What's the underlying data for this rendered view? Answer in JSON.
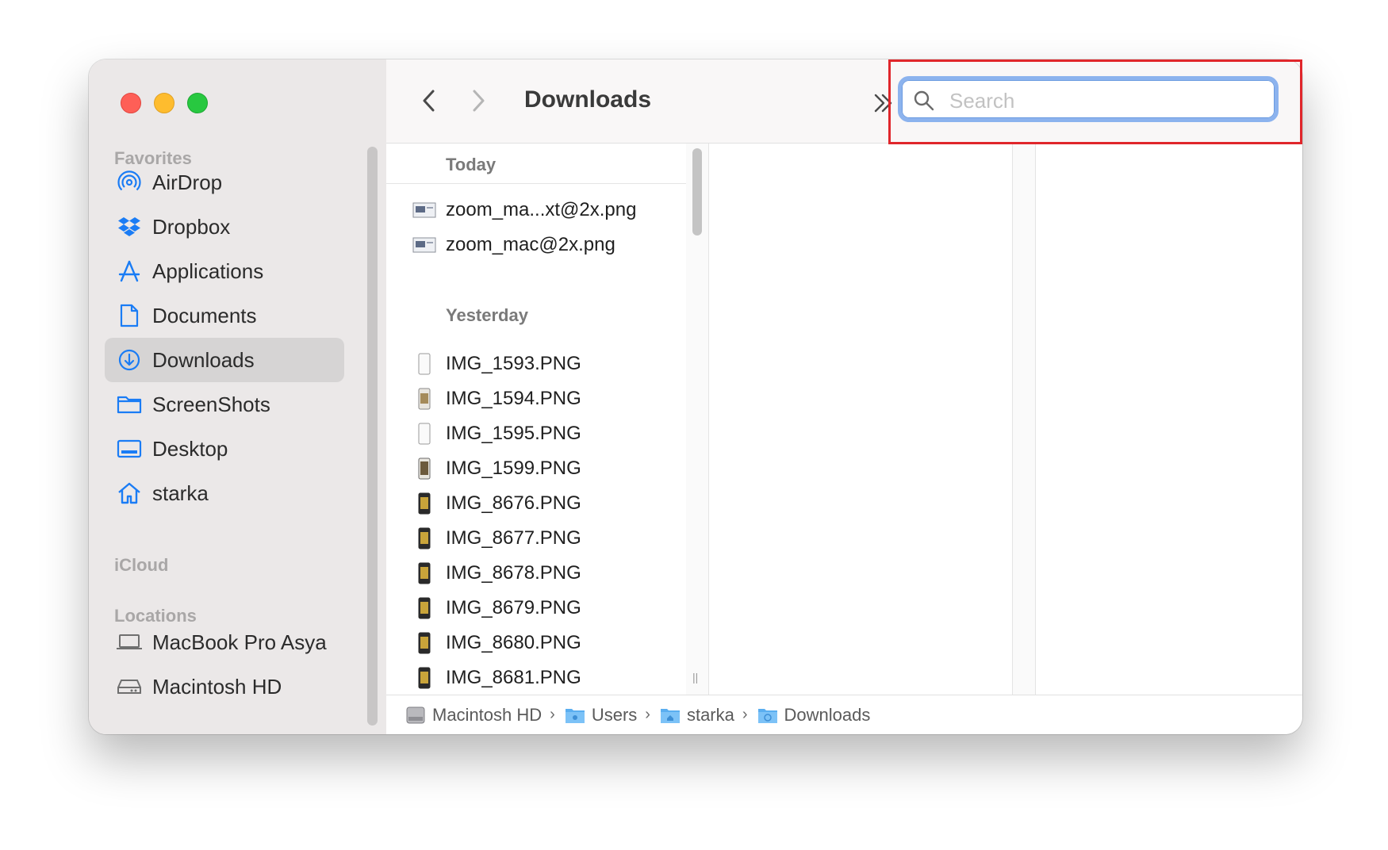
{
  "window": {
    "title": "Downloads"
  },
  "sidebar": {
    "sections": {
      "favorites": "Favorites",
      "icloud": "iCloud",
      "locations": "Locations"
    },
    "items": [
      {
        "label": "AirDrop",
        "icon": "airdrop-icon"
      },
      {
        "label": "Dropbox",
        "icon": "dropbox-icon"
      },
      {
        "label": "Applications",
        "icon": "applications-icon"
      },
      {
        "label": "Documents",
        "icon": "document-icon"
      },
      {
        "label": "Downloads",
        "icon": "downloads-icon",
        "selected": true
      },
      {
        "label": "ScreenShots",
        "icon": "folder-icon"
      },
      {
        "label": "Desktop",
        "icon": "desktop-icon"
      },
      {
        "label": "starka",
        "icon": "home-icon"
      }
    ],
    "locations": [
      {
        "label": "MacBook Pro Asya",
        "icon": "laptop-icon"
      },
      {
        "label": "Macintosh HD",
        "icon": "hard-drive-icon"
      }
    ]
  },
  "toolbar": {
    "title": "Downloads",
    "search_placeholder": "Search",
    "search_value": ""
  },
  "files": {
    "today_label": "Today",
    "today": [
      "zoom_ma...xt@2x.png",
      "zoom_mac@2x.png"
    ],
    "yesterday_label": "Yesterday",
    "yesterday": [
      "IMG_1593.PNG",
      "IMG_1594.PNG",
      "IMG_1595.PNG",
      "IMG_1599.PNG",
      "IMG_8676.PNG",
      "IMG_8677.PNG",
      "IMG_8678.PNG",
      "IMG_8679.PNG",
      "IMG_8680.PNG",
      "IMG_8681.PNG"
    ]
  },
  "pathbar": {
    "crumbs": [
      "Macintosh HD",
      "Users",
      "starka",
      "Downloads"
    ]
  },
  "colors": {
    "accent": "#1a7cf5",
    "sidebar_bg": "#ebe8e8",
    "selection_bg": "#d6d4d4",
    "highlight_box": "#e0262b"
  }
}
